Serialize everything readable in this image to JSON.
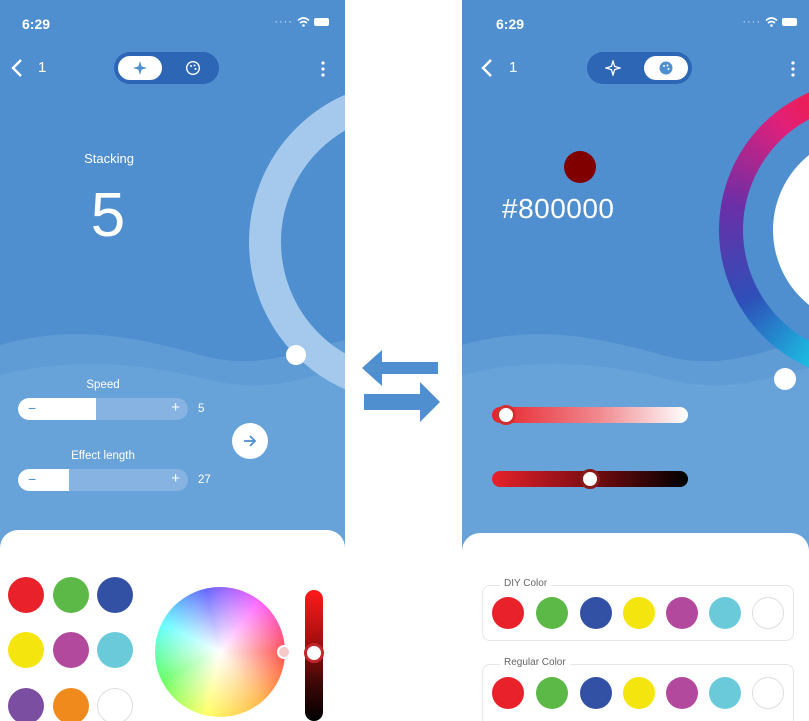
{
  "left_screen": {
    "status": {
      "time": "6:29"
    },
    "nav": {
      "back_count": "1"
    },
    "mode": {
      "title": "Stacking",
      "value": "5"
    },
    "sliders": [
      {
        "label": "Speed",
        "value": "5",
        "fill": 0.46
      },
      {
        "label": "Effect length",
        "value": "27",
        "fill": 0.3
      }
    ],
    "stepper_symbols": {
      "minus": "−",
      "plus": "+"
    },
    "preset_colors": [
      "#e8212b",
      "#5cb947",
      "#3251a4",
      "#f4e50e",
      "#b3499c",
      "#6acad9",
      "#7c4ea2",
      "#f18a1c",
      "#ffffff"
    ],
    "colors": {
      "primary": "#4f8fcf",
      "wave_light": "#6ea7dc",
      "card": "#ffffff"
    }
  },
  "right_screen": {
    "status": {
      "time": "6:29"
    },
    "nav": {
      "back_count": "1"
    },
    "selected_color": {
      "hex": "#800000",
      "swatch": "#800000"
    },
    "saturation_slider": {
      "fill": 0.02
    },
    "brightness_slider": {
      "fill": 0.5
    },
    "diy_section": {
      "label": "DIY Color",
      "colors": [
        "#e8212b",
        "#5cb947",
        "#3251a4",
        "#f4e50e",
        "#b3499c",
        "#6acad9",
        "#ffffff"
      ]
    },
    "regular_section": {
      "label": "Regular Color",
      "colors": [
        "#e8212b",
        "#5cb947",
        "#3251a4",
        "#f4e50e",
        "#b3499c",
        "#6acad9",
        "#ffffff"
      ]
    }
  },
  "swap_icon": {
    "color": "#4f8fcf",
    "name": "swap-arrows-icon"
  }
}
